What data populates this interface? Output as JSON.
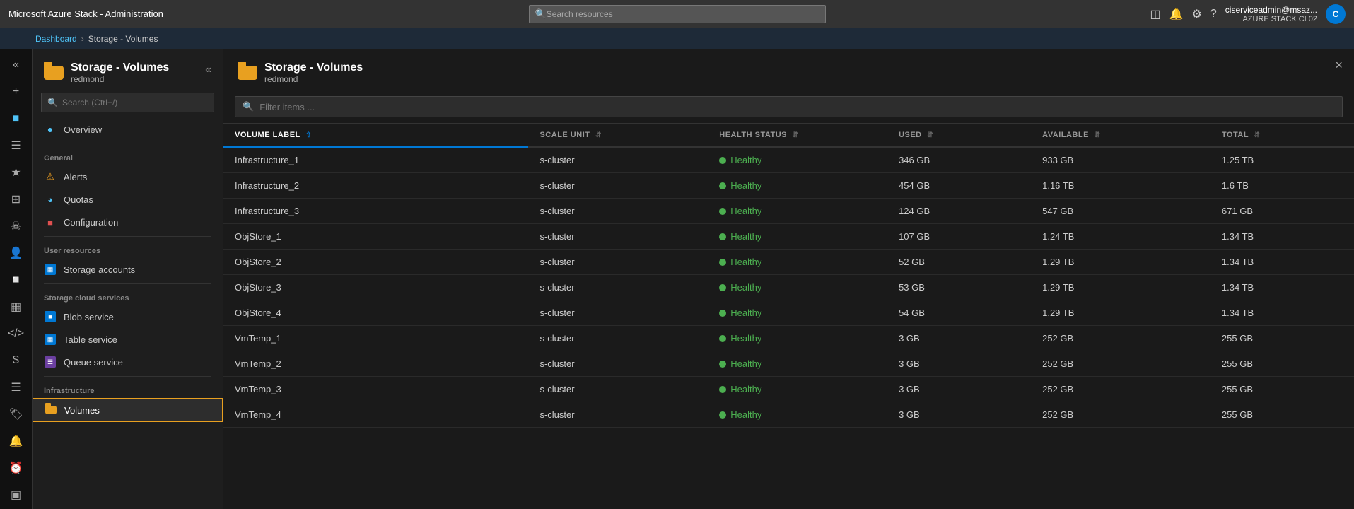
{
  "app": {
    "title": "Microsoft Azure Stack - Administration",
    "close_label": "×",
    "collapse_label": "«"
  },
  "topbar": {
    "title": "Microsoft Azure Stack - Administration",
    "search_placeholder": "Search resources",
    "user": {
      "name": "ciserviceadmin@msaz...",
      "subtitle": "AZURE STACK CI 02",
      "initials": "C"
    }
  },
  "breadcrumb": {
    "items": [
      "Dashboard",
      "Storage - Volumes"
    ]
  },
  "left_nav": {
    "title": "Storage - Volumes",
    "subtitle": "redmond",
    "search_placeholder": "Search (Ctrl+/)",
    "sections": [
      {
        "label": "",
        "items": [
          {
            "id": "overview",
            "label": "Overview",
            "icon": "globe"
          }
        ]
      },
      {
        "label": "General",
        "items": [
          {
            "id": "alerts",
            "label": "Alerts",
            "icon": "alert"
          },
          {
            "id": "quotas",
            "label": "Quotas",
            "icon": "quota"
          },
          {
            "id": "configuration",
            "label": "Configuration",
            "icon": "config"
          }
        ]
      },
      {
        "label": "User resources",
        "items": [
          {
            "id": "storage-accounts",
            "label": "Storage accounts",
            "icon": "storage"
          }
        ]
      },
      {
        "label": "Storage cloud services",
        "items": [
          {
            "id": "blob-service",
            "label": "Blob service",
            "icon": "blob"
          },
          {
            "id": "table-service",
            "label": "Table service",
            "icon": "table"
          },
          {
            "id": "queue-service",
            "label": "Queue service",
            "icon": "queue"
          }
        ]
      },
      {
        "label": "Infrastructure",
        "items": [
          {
            "id": "volumes",
            "label": "Volumes",
            "icon": "folder",
            "active": true
          }
        ]
      }
    ]
  },
  "main": {
    "title": "Storage - Volumes",
    "subtitle": "redmond",
    "filter_placeholder": "Filter items ...",
    "columns": [
      {
        "id": "volume_label",
        "label": "VOLUME LABEL",
        "sort": "asc"
      },
      {
        "id": "scale_unit",
        "label": "SCALE UNIT",
        "sort": null
      },
      {
        "id": "health_status",
        "label": "HEALTH STATUS",
        "sort": null
      },
      {
        "id": "used",
        "label": "USED",
        "sort": null
      },
      {
        "id": "available",
        "label": "AVAILABLE",
        "sort": null
      },
      {
        "id": "total",
        "label": "TOTAL",
        "sort": null
      }
    ],
    "rows": [
      {
        "volume_label": "Infrastructure_1",
        "scale_unit": "s-cluster",
        "health_status": "Healthy",
        "used": "346 GB",
        "available": "933 GB",
        "total": "1.25 TB"
      },
      {
        "volume_label": "Infrastructure_2",
        "scale_unit": "s-cluster",
        "health_status": "Healthy",
        "used": "454 GB",
        "available": "1.16 TB",
        "total": "1.6 TB"
      },
      {
        "volume_label": "Infrastructure_3",
        "scale_unit": "s-cluster",
        "health_status": "Healthy",
        "used": "124 GB",
        "available": "547 GB",
        "total": "671 GB"
      },
      {
        "volume_label": "ObjStore_1",
        "scale_unit": "s-cluster",
        "health_status": "Healthy",
        "used": "107 GB",
        "available": "1.24 TB",
        "total": "1.34 TB"
      },
      {
        "volume_label": "ObjStore_2",
        "scale_unit": "s-cluster",
        "health_status": "Healthy",
        "used": "52 GB",
        "available": "1.29 TB",
        "total": "1.34 TB"
      },
      {
        "volume_label": "ObjStore_3",
        "scale_unit": "s-cluster",
        "health_status": "Healthy",
        "used": "53 GB",
        "available": "1.29 TB",
        "total": "1.34 TB"
      },
      {
        "volume_label": "ObjStore_4",
        "scale_unit": "s-cluster",
        "health_status": "Healthy",
        "used": "54 GB",
        "available": "1.29 TB",
        "total": "1.34 TB"
      },
      {
        "volume_label": "VmTemp_1",
        "scale_unit": "s-cluster",
        "health_status": "Healthy",
        "used": "3 GB",
        "available": "252 GB",
        "total": "255 GB"
      },
      {
        "volume_label": "VmTemp_2",
        "scale_unit": "s-cluster",
        "health_status": "Healthy",
        "used": "3 GB",
        "available": "252 GB",
        "total": "255 GB"
      },
      {
        "volume_label": "VmTemp_3",
        "scale_unit": "s-cluster",
        "health_status": "Healthy",
        "used": "3 GB",
        "available": "252 GB",
        "total": "255 GB"
      },
      {
        "volume_label": "VmTemp_4",
        "scale_unit": "s-cluster",
        "health_status": "Healthy",
        "used": "3 GB",
        "available": "252 GB",
        "total": "255 GB"
      }
    ]
  }
}
